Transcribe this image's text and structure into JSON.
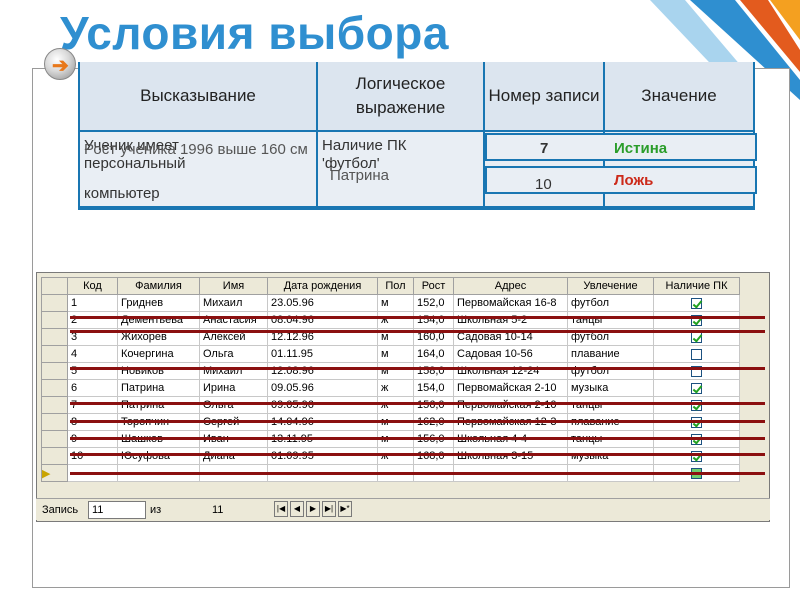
{
  "slide": {
    "title": "Условия выбора"
  },
  "upper_table": {
    "headers": [
      "Высказывание",
      "Логическое выражение",
      "Номер записи",
      "Значение"
    ],
    "row_texts": {
      "col1_line1": "Ученик имеет",
      "col1_line2": "персональный",
      "col1_line3": "компьютер",
      "col1_overlay": "Рост ученика 1996 выше 160 см",
      "col2_line1": "Наличие ПК",
      "col2_line2": "'футбол'",
      "col2_overlay": "Патрина",
      "col3_top": "7",
      "col3_bottom": "10",
      "col4_top": "Истина",
      "col4_bottom": "Ложь"
    }
  },
  "datasheet": {
    "columns": [
      "Код",
      "Фамилия",
      "Имя",
      "Дата рождения",
      "Пол",
      "Рост",
      "Адрес",
      "Увлечение",
      "Наличие ПК"
    ],
    "rows": [
      [
        "1",
        "Гриднев",
        "Михаил",
        "23.05.96",
        "м",
        "152,0",
        "Первомайская 16-8",
        "футбол",
        true
      ],
      [
        "2",
        "Дементьева",
        "Анастасия",
        "08.04.96",
        "ж",
        "154,0",
        "Школьная 5-2",
        "танцы",
        true
      ],
      [
        "3",
        "Жихорев",
        "Алексей",
        "12.12.96",
        "м",
        "160,0",
        "Садовая 10-14",
        "футбол",
        true
      ],
      [
        "4",
        "Кочергина",
        "Ольга",
        "01.11.95",
        "м",
        "164,0",
        "Садовая 10-56",
        "плавание",
        false
      ],
      [
        "5",
        "Новиков",
        "Михаил",
        "12.08.96",
        "м",
        "158,0",
        "Школьная 12-24",
        "футбол",
        false
      ],
      [
        "6",
        "Патрина",
        "Ирина",
        "09.05.96",
        "ж",
        "154,0",
        "Первомайская 2-10",
        "музыка",
        true
      ],
      [
        "7",
        "Патрина",
        "Ольга",
        "09.05.96",
        "ж",
        "156,0",
        "Первомайская 2-10",
        "танцы",
        true
      ],
      [
        "8",
        "Торопчин",
        "Сергей",
        "14.04.96",
        "м",
        "162,0",
        "Первомайская 12-3",
        "плавание",
        true
      ],
      [
        "9",
        "Шашков",
        "Иван",
        "13.11.95",
        "м",
        "156,0",
        "Школьная 4-4",
        "танцы",
        true
      ],
      [
        "10",
        "Юсуфова",
        "Диана",
        "01.09.95",
        "ж",
        "168,0",
        "Школьная 3-15",
        "музыка",
        true
      ]
    ],
    "nav": {
      "record_label": "Запись",
      "record_value": "11",
      "of_label": "из",
      "total": "11"
    }
  }
}
